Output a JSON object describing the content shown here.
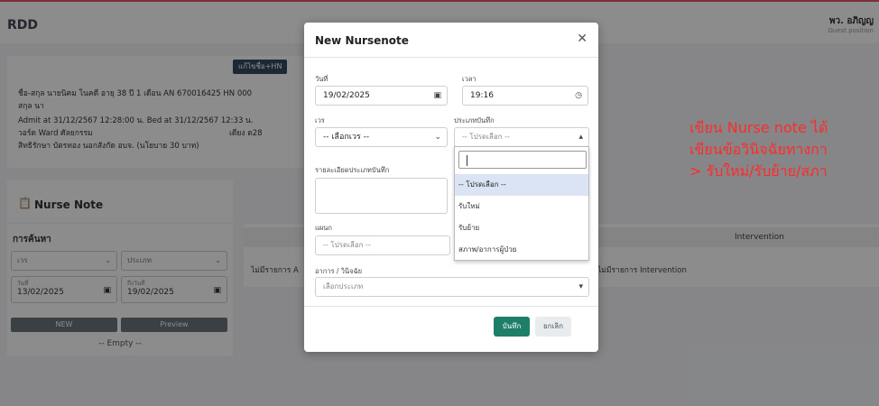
{
  "app": {
    "brand": "RDD",
    "user_name": "พว. อภิญญ",
    "user_role": "Guest position"
  },
  "patient": {
    "edit_button": "แก้ไขชื่อ+HN",
    "line1": "ชื่อ-สกุล นายนิคม โนคดี อายุ 38 ปี 1 เดือน AN 670016425 HN 000",
    "line2": "สกุล นา",
    "admit": "Admit at 31/12/2567 12:28:00 น.   Bed at 31/12/2567 12:33 น.",
    "ward": "วอร์ด Ward ศัลยกรรม",
    "bed": "เตียง ต28",
    "rights": "สิทธิรักษา บัตรทอง นอกสังกัด อบจ. (นโยบาย 30 บาท)"
  },
  "nurse_note": {
    "title": "Nurse Note",
    "search_title": "การค้นหา",
    "shift_select": "เวร",
    "type_select": "ประเภท",
    "date_from_label": "วันที่",
    "date_from": "13/02/2025",
    "date_to_label": "ถึงวันที่",
    "date_to": "19/02/2025",
    "new_button": "NEW",
    "preview_button": "Preview",
    "empty": "-- Empty --"
  },
  "table": {
    "header_intervention": "Intervention",
    "empty_assessment": "ไม่มีรายการ A",
    "empty_intervention": "ไม่มีรายการ Intervention"
  },
  "modal": {
    "title": "New Nursenote",
    "date_label": "วันที่",
    "date_value": "19/02/2025",
    "time_label": "เวลา",
    "time_value": "19:16",
    "shift_label": "เวร",
    "shift_value": "-- เลือกเวร --",
    "note_type_label": "ประเภทบันทึก",
    "note_type_placeholder": "-- โปรดเลือก --",
    "detail_label": "รายละเอียดประเภทบันทึก",
    "department_label": "แผนก",
    "department_placeholder": "-- โปรดเลือก --",
    "symptom_label": "อาการ / วินิจฉัย",
    "symptom_placeholder": "เลือกประเภท",
    "save_button": "บันทึก",
    "cancel_button": "ยกเลิก"
  },
  "dropdown": {
    "options": [
      "-- โปรดเลือก --",
      "รับใหม่",
      "รับย้าย",
      "สภาพ/อาการผู้ป่วย"
    ]
  },
  "annotation": {
    "line1": "เขียน Nurse note ได้",
    "line2": "เขียนข้อวินิจฉัยทางกา",
    "line3": "> รับใหม่/รับย้าย/สภา"
  }
}
